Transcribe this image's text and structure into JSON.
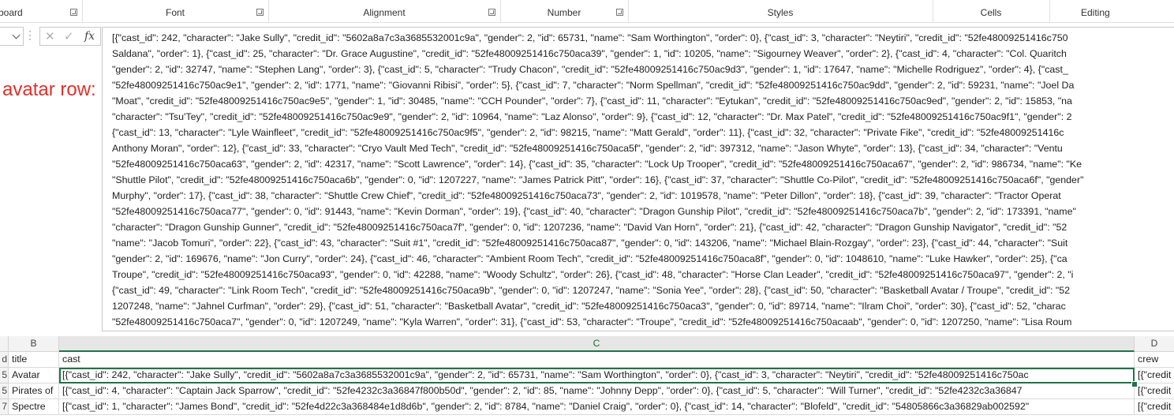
{
  "ribbon": {
    "groups": [
      {
        "label": "board",
        "launcher": true
      },
      {
        "label": "Font",
        "launcher": true
      },
      {
        "label": "Alignment",
        "launcher": true
      },
      {
        "label": "Number",
        "launcher": true
      },
      {
        "label": "Styles",
        "launcher": false
      },
      {
        "label": "Cells",
        "launcher": false
      },
      {
        "label": "Editing",
        "launcher": false
      }
    ]
  },
  "formula_bar": {
    "fx_label": "fx",
    "lines": [
      "[{\"cast_id\": 242, \"character\": \"Jake Sully\", \"credit_id\": \"5602a8a7c3a3685532001c9a\", \"gender\": 2, \"id\": 65731, \"name\": \"Sam Worthington\", \"order\": 0}, {\"cast_id\": 3, \"character\": \"Neytiri\", \"credit_id\": \"52fe48009251416c750",
      "Saldana\", \"order\": 1}, {\"cast_id\": 25, \"character\": \"Dr. Grace Augustine\", \"credit_id\": \"52fe48009251416c750aca39\", \"gender\": 1, \"id\": 10205, \"name\": \"Sigourney Weaver\", \"order\": 2}, {\"cast_id\": 4, \"character\": \"Col. Quaritch",
      "\"gender\": 2, \"id\": 32747, \"name\": \"Stephen Lang\", \"order\": 3}, {\"cast_id\": 5, \"character\": \"Trudy Chacon\", \"credit_id\": \"52fe48009251416c750ac9d3\", \"gender\": 1, \"id\": 17647, \"name\": \"Michelle Rodriguez\", \"order\": 4}, {\"cast_",
      "\"52fe48009251416c750ac9e1\", \"gender\": 2, \"id\": 1771, \"name\": \"Giovanni Ribisi\", \"order\": 5}, {\"cast_id\": 7, \"character\": \"Norm Spellman\", \"credit_id\": \"52fe48009251416c750ac9dd\", \"gender\": 2, \"id\": 59231, \"name\": \"Joel Da",
      "\"Moat\", \"credit_id\": \"52fe48009251416c750ac9e5\", \"gender\": 1, \"id\": 30485, \"name\": \"CCH Pounder\", \"order\": 7}, {\"cast_id\": 11, \"character\": \"Eytukan\", \"credit_id\": \"52fe48009251416c750ac9ed\", \"gender\": 2, \"id\": 15853, \"na",
      "\"character\": \"Tsu'Tey\", \"credit_id\": \"52fe48009251416c750ac9e9\", \"gender\": 2, \"id\": 10964, \"name\": \"Laz Alonso\", \"order\": 9}, {\"cast_id\": 12, \"character\": \"Dr. Max Patel\", \"credit_id\": \"52fe48009251416c750ac9f1\", \"gender\": 2",
      "{\"cast_id\": 13, \"character\": \"Lyle Wainfleet\", \"credit_id\": \"52fe48009251416c750ac9f5\", \"gender\": 2, \"id\": 98215, \"name\": \"Matt Gerald\", \"order\": 11}, {\"cast_id\": 32, \"character\": \"Private Fike\", \"credit_id\": \"52fe48009251416c",
      "Anthony Moran\", \"order\": 12}, {\"cast_id\": 33, \"character\": \"Cryo Vault Med Tech\", \"credit_id\": \"52fe48009251416c750aca5f\", \"gender\": 2, \"id\": 397312, \"name\": \"Jason Whyte\", \"order\": 13}, {\"cast_id\": 34, \"character\": \"Ventu",
      "\"52fe48009251416c750aca63\", \"gender\": 2, \"id\": 42317, \"name\": \"Scott Lawrence\", \"order\": 14}, {\"cast_id\": 35, \"character\": \"Lock Up Trooper\", \"credit_id\": \"52fe48009251416c750aca67\", \"gender\": 2, \"id\": 986734, \"name\": \"Ke",
      "\"Shuttle Pilot\", \"credit_id\": \"52fe48009251416c750aca6b\", \"gender\": 0, \"id\": 1207227, \"name\": \"James Patrick Pitt\", \"order\": 16}, {\"cast_id\": 37, \"character\": \"Shuttle Co-Pilot\", \"credit_id\": \"52fe48009251416c750aca6f\", \"gender\"",
      "Murphy\", \"order\": 17}, {\"cast_id\": 38, \"character\": \"Shuttle Crew Chief\", \"credit_id\": \"52fe48009251416c750aca73\", \"gender\": 2, \"id\": 1019578, \"name\": \"Peter Dillon\", \"order\": 18}, {\"cast_id\": 39, \"character\": \"Tractor Operat",
      "\"52fe48009251416c750aca77\", \"gender\": 0, \"id\": 91443, \"name\": \"Kevin Dorman\", \"order\": 19}, {\"cast_id\": 40, \"character\": \"Dragon Gunship Pilot\", \"credit_id\": \"52fe48009251416c750aca7b\", \"gender\": 2, \"id\": 173391, \"name\"",
      "\"character\": \"Dragon Gunship Gunner\", \"credit_id\": \"52fe48009251416c750aca7f\", \"gender\": 0, \"id\": 1207236, \"name\": \"David Van Horn\", \"order\": 21}, {\"cast_id\": 42, \"character\": \"Dragon Gunship Navigator\", \"credit_id\": \"52",
      "\"name\": \"Jacob Tomuri\", \"order\": 22}, {\"cast_id\": 43, \"character\": \"Suit #1\", \"credit_id\": \"52fe48009251416c750aca87\", \"gender\": 0, \"id\": 143206, \"name\": \"Michael Blain-Rozgay\", \"order\": 23}, {\"cast_id\": 44, \"character\": \"Suit",
      "\"gender\": 2, \"id\": 169676, \"name\": \"Jon Curry\", \"order\": 24}, {\"cast_id\": 46, \"character\": \"Ambient Room Tech\", \"credit_id\": \"52fe48009251416c750aca8f\", \"gender\": 0, \"id\": 1048610, \"name\": \"Luke Hawker\", \"order\": 25}, {\"ca",
      "Troupe\", \"credit_id\": \"52fe48009251416c750aca93\", \"gender\": 0, \"id\": 42288, \"name\": \"Woody Schultz\", \"order\": 26}, {\"cast_id\": 48, \"character\": \"Horse Clan Leader\", \"credit_id\": \"52fe48009251416c750aca97\", \"gender\": 2, \"i",
      "{\"cast_id\": 49, \"character\": \"Link Room Tech\", \"credit_id\": \"52fe48009251416c750aca9b\", \"gender\": 0, \"id\": 1207247, \"name\": \"Sonia Yee\", \"order\": 28}, {\"cast_id\": 50, \"character\": \"Basketball Avatar / Troupe\", \"credit_id\": \"52",
      "1207248, \"name\": \"Jahnel Curfman\", \"order\": 29}, {\"cast_id\": 51, \"character\": \"Basketball Avatar\", \"credit_id\": \"52fe48009251416c750aca3\", \"gender\": 0, \"id\": 89714, \"name\": \"Ilram Choi\", \"order\": 30}, {\"cast_id\": 52, \"charac",
      "\"52fe48009251416c750aca7\", \"gender\": 0, \"id\": 1207249, \"name\": \"Kyla Warren\", \"order\": 31}, {\"cast_id\": 53, \"character\": \"Troupe\", \"credit_id\": \"52fe48009251416c750acaab\", \"gender\": 0, \"id\": 1207250, \"name\": \"Lisa Roum"
    ]
  },
  "annotation": "avatar row:",
  "grid": {
    "columns": [
      "B",
      "C",
      "D"
    ],
    "first_col_partial": "",
    "header_row": {
      "a": "d",
      "b": "title",
      "c": "cast",
      "d": "crew"
    },
    "rows": [
      {
        "row_num": "5",
        "title": "Avatar",
        "cast": "[{\"cast_id\": 242, \"character\": \"Jake Sully\", \"credit_id\": \"5602a8a7c3a3685532001c9a\", \"gender\": 2, \"id\": 65731, \"name\": \"Sam Worthington\", \"order\": 0}, {\"cast_id\": 3, \"character\": \"Neytiri\", \"credit_id\": \"52fe48009251416c750ac",
        "crew": "[{\"credit"
      },
      {
        "row_num": "5",
        "title": "Pirates of",
        "cast": "[{\"cast_id\": 4, \"character\": \"Captain Jack Sparrow\", \"credit_id\": \"52fe4232c3a36847f800b50d\", \"gender\": 2, \"id\": 85, \"name\": \"Johnny Depp\", \"order\": 0}, {\"cast_id\": 5, \"character\": \"Will Turner\", \"credit_id\": \"52fe4232c3a36847",
        "crew": "[{\"credit"
      },
      {
        "row_num": "7",
        "title": "Spectre",
        "cast": "[{\"cast_id\": 1, \"character\": \"James Bond\", \"credit_id\": \"52fe4d22c3a368484e1d8d6b\", \"gender\": 2, \"id\": 8784, \"name\": \"Daniel Craig\", \"order\": 0}, {\"cast_id\": 14, \"character\": \"Blofeld\", \"credit_id\": \"54805866c3a36829ab002592\"",
        "crew": "[{\"credit"
      }
    ]
  },
  "colors": {
    "accent": "#217346",
    "annotation": "#e0302a"
  }
}
